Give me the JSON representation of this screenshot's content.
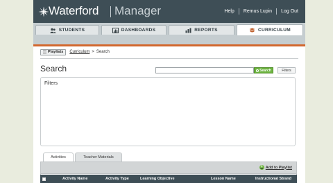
{
  "app": {
    "logo_name": "Waterford",
    "logo_sub": "Manager",
    "top_links": [
      "Help",
      "Remus Lupin",
      "Log Out"
    ]
  },
  "tabs": [
    {
      "label": "STUDENTS",
      "icon": "students-icon",
      "active": false
    },
    {
      "label": "DASHBOARDS",
      "icon": "dashboards-icon",
      "active": false
    },
    {
      "label": "REPORTS",
      "icon": "reports-icon",
      "active": false
    },
    {
      "label": "CURRICULUM",
      "icon": "curriculum-icon",
      "active": true
    }
  ],
  "breadcrumb": {
    "playlists_label": "Playlists",
    "link": "Curriculum",
    "separator": ">",
    "current": "Search"
  },
  "page": {
    "title": "Search",
    "search_value": "",
    "search_button": "Search",
    "filters_button": "Filters"
  },
  "filters_panel": {
    "title": "Filters"
  },
  "subtabs": [
    {
      "label": "Activities",
      "active": true
    },
    {
      "label": "Teacher Materials",
      "active": false
    }
  ],
  "toolbar": {
    "add_label": "Add to Playlist"
  },
  "table": {
    "columns": [
      "Activity Name",
      "Activity Type",
      "Learning Objective",
      "Lesson Name",
      "Instructional Strand"
    ]
  },
  "colors": {
    "header": "#3e4e56",
    "accent_orange": "#d2672e",
    "search_green": "#6cb33f",
    "background": "#e9ecde"
  }
}
